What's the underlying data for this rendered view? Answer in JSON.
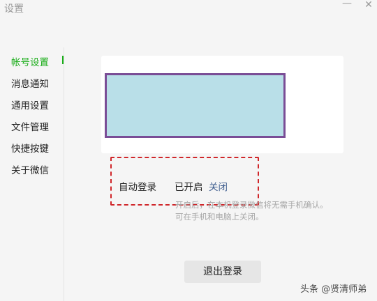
{
  "window": {
    "title": "设置",
    "minimize_glyph": "—",
    "close_glyph": "✕"
  },
  "sidebar": {
    "items": [
      {
        "label": "帐号设置",
        "active": true
      },
      {
        "label": "消息通知",
        "active": false
      },
      {
        "label": "通用设置",
        "active": false
      },
      {
        "label": "文件管理",
        "active": false
      },
      {
        "label": "快捷按键",
        "active": false
      },
      {
        "label": "关于微信",
        "active": false
      }
    ]
  },
  "account": {
    "auto_login_label": "自动登录",
    "auto_login_status": "已开启",
    "auto_login_toggle": "关闭",
    "hint_line1": "开启后，在本机登录微信将无需手机确认。",
    "hint_line2": "可在手机和电脑上关闭。",
    "logout_label": "退出登录"
  },
  "watermark": "头条 @贤清师弟",
  "colors": {
    "accent_active": "#1aad19",
    "link": "#3f5e8f",
    "annotation_box": "#d0262a",
    "placeholder_fill": "#b9dfe8",
    "placeholder_border": "#7a4d96"
  }
}
